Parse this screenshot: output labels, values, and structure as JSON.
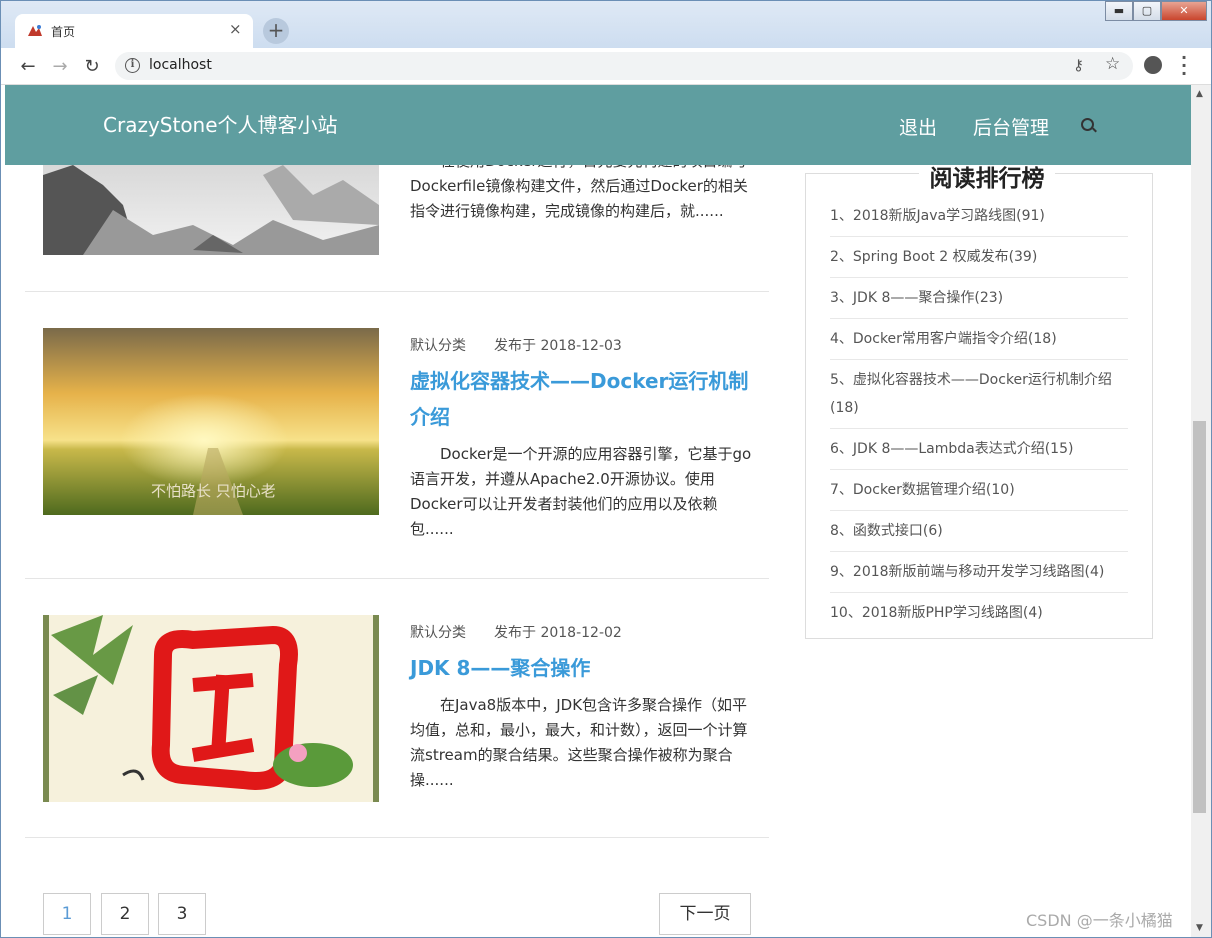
{
  "browser": {
    "tab_title": "首页",
    "tab_close": "×",
    "new_tab": "+",
    "url": "localhost",
    "win_min": "▬",
    "win_max": "▢",
    "win_close": "✕"
  },
  "header": {
    "brand": "CrazyStone个人博客小站",
    "logout": "退出",
    "admin": "后台管理"
  },
  "posts": [
    {
      "excerpt_fragment": "在使用Docker进行，首先要先构建的项目编写Dockerfile镜像构建文件，然后通过Docker的相关指令进行镜像构建，完成镜像的构建后，就......"
    },
    {
      "category": "默认分类",
      "date": "发布于 2018-12-03",
      "title": "虚拟化容器技术——Docker运行机制介绍",
      "excerpt": "Docker是一个开源的应用容器引擎，它基于go语言开发，并遵从Apache2.0开源协议。使用Docker可以让开发者封装他们的应用以及依赖包......",
      "image_caption": "不怕路长 只怕心老"
    },
    {
      "category": "默认分类",
      "date": "发布于 2018-12-02",
      "title": "JDK 8——聚合操作",
      "excerpt": "在Java8版本中，JDK包含许多聚合操作（如平均值，总和，最小，最大，和计数），返回一个计算流stream的聚合结果。这些聚合操作被称为聚合操......"
    }
  ],
  "sidebar": {
    "title": "阅读排行榜",
    "items": [
      "1、2018新版Java学习路线图(91)",
      "2、Spring Boot 2 权威发布(39)",
      "3、JDK 8——聚合操作(23)",
      "4、Docker常用客户端指令介绍(18)",
      "5、虚拟化容器技术——Docker运行机制介绍(18)",
      "6、JDK 8——Lambda表达式介绍(15)",
      "7、Docker数据管理介绍(10)",
      "8、函数式接口(6)",
      "9、2018新版前端与移动开发学习线路图(4)",
      "10、2018新版PHP学习线路图(4)"
    ]
  },
  "pagination": {
    "pages": [
      "1",
      "2",
      "3"
    ],
    "current": "1",
    "next": "下一页"
  },
  "watermark": "CSDN @一条小橘猫",
  "colors": {
    "header_bg": "#5f9ea0",
    "title_link": "#3a9ad9"
  }
}
